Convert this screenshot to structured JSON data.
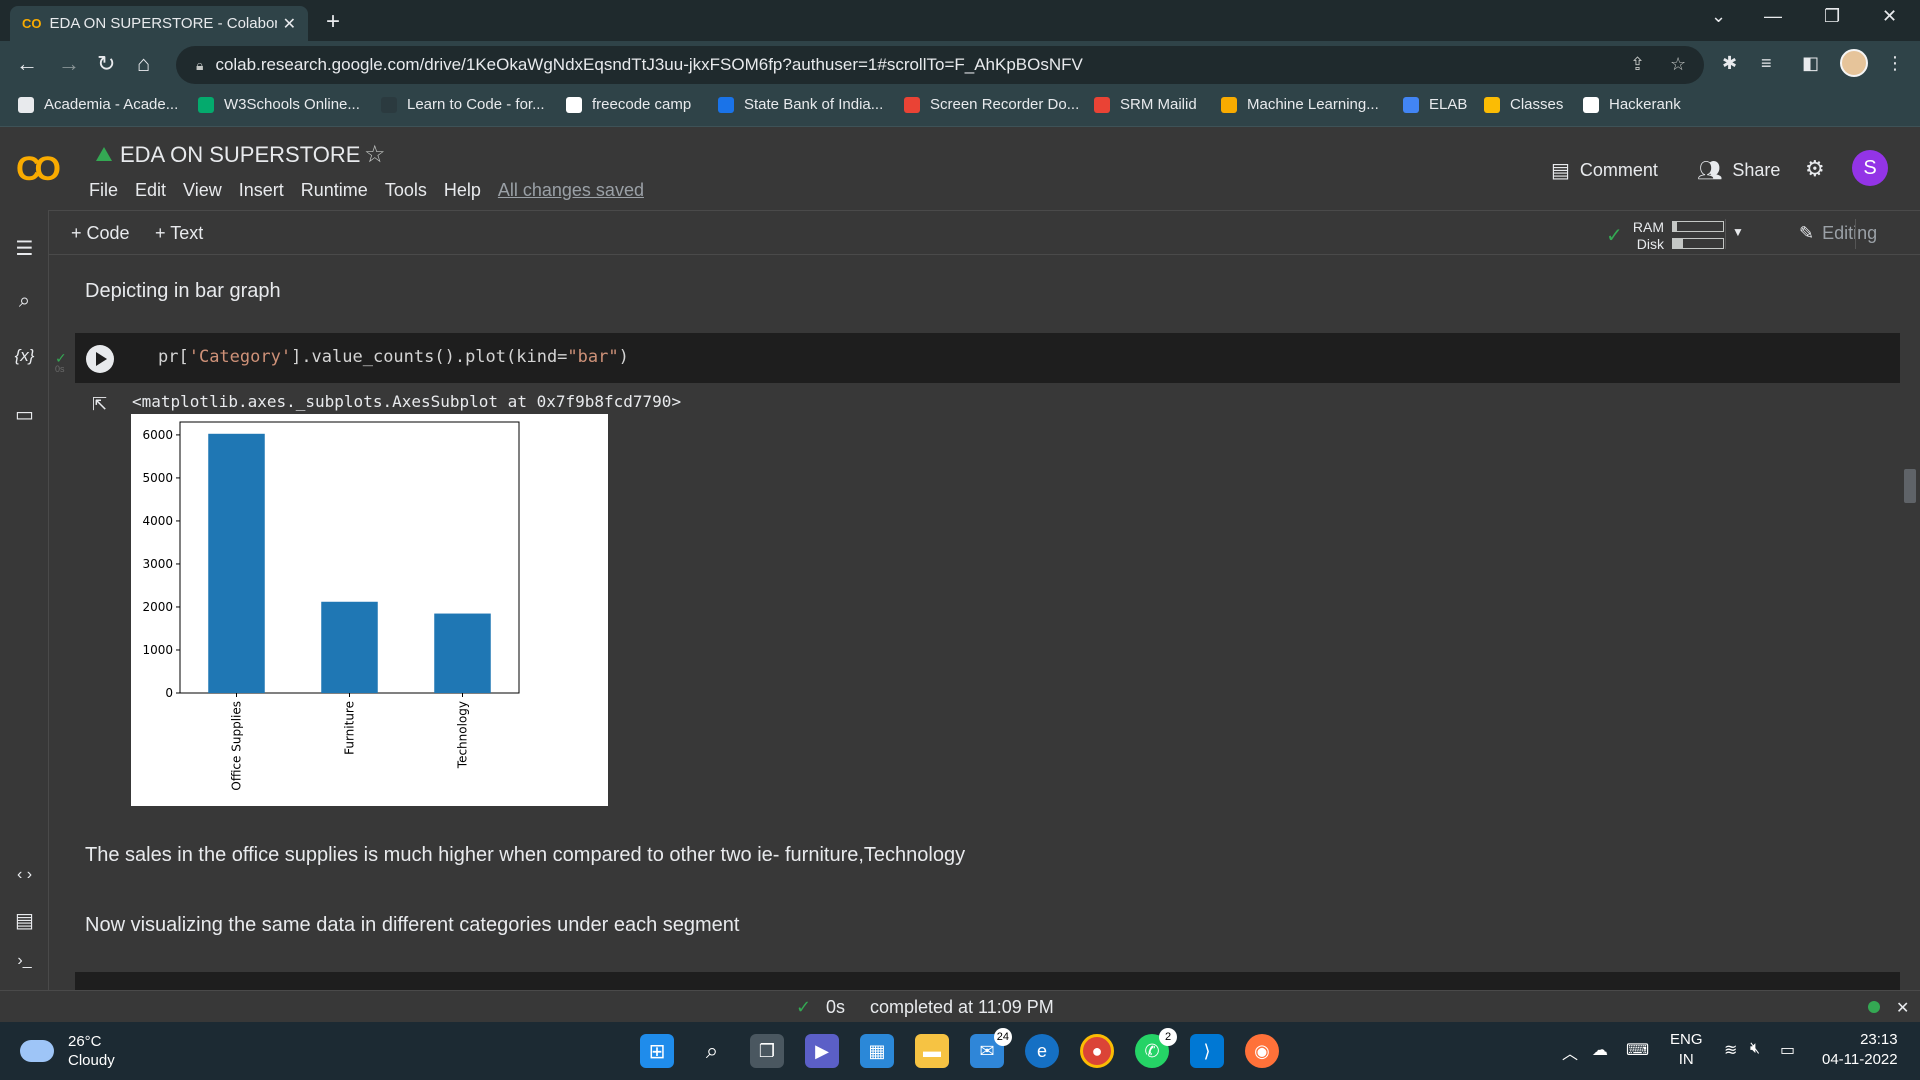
{
  "browser": {
    "tab_title": "EDA ON SUPERSTORE - Colaboratory",
    "url": "colab.research.google.com/drive/1KeOkaWgNdxEqsndTtJ3uu-jkxFSOM6fp?authuser=1#scrollTo=F_AhKpBOsNFV",
    "bookmarks": [
      {
        "label": "Academia - Acade...",
        "icon": "academia-icon",
        "color": "#e8eaed"
      },
      {
        "label": "W3Schools Online...",
        "icon": "w3schools-icon",
        "color": "#04aa6d"
      },
      {
        "label": "Learn to Code - for...",
        "icon": "freecodecamp-icon",
        "color": "#2b3a3f"
      },
      {
        "label": "freecode camp",
        "icon": "freecodecamp-icon",
        "color": "#ffffff"
      },
      {
        "label": "State Bank of India...",
        "icon": "sbi-icon",
        "color": "#1a73e8"
      },
      {
        "label": "Screen Recorder Do...",
        "icon": "record-icon",
        "color": "#ea4335"
      },
      {
        "label": "SRM Mailid",
        "icon": "gmail-icon",
        "color": "#ea4335"
      },
      {
        "label": "Machine Learning...",
        "icon": "ml-icon",
        "color": "#f9ab00"
      },
      {
        "label": "ELAB",
        "icon": "elab-icon",
        "color": "#4285f4"
      },
      {
        "label": "Classes",
        "icon": "classroom-icon",
        "color": "#fbbc04"
      },
      {
        "label": "Hackerank",
        "icon": "hackerrank-icon",
        "color": "#ffffff"
      }
    ]
  },
  "colab": {
    "logo": "CO",
    "notebook_name": "EDA ON SUPERSTORE",
    "menu": [
      "File",
      "Edit",
      "View",
      "Insert",
      "Runtime",
      "Tools",
      "Help"
    ],
    "saved_status": "All changes saved",
    "comment_label": "Comment",
    "share_label": "Share",
    "avatar_letter": "S",
    "add_code_label": "+ Code",
    "add_text_label": "+ Text",
    "ram_label": "RAM",
    "disk_label": "Disk",
    "ram_usage": 0.08,
    "disk_usage": 0.2,
    "editing_label": "Editing"
  },
  "cells": {
    "md_heading": "Depicting in bar graph",
    "code_prefix": "pr[",
    "code_str1": "'Category'",
    "code_mid": "].value_counts().plot(kind=",
    "code_str2": "\"bar\"",
    "code_suffix": ")",
    "exec_time": "0s",
    "output_text": "<matplotlib.axes._subplots.AxesSubplot at 0x7f9b8fcd7790>",
    "md_conclusion": "The sales in the office supplies is much higher when compared to other two ie- furniture,Technology",
    "md_next": "Now visualizing the same data in different categories under each segment"
  },
  "chart_data": {
    "type": "bar",
    "categories": [
      "Office Supplies",
      "Furniture",
      "Technology"
    ],
    "values": [
      6026,
      2121,
      1847
    ],
    "title": "",
    "xlabel": "",
    "ylabel": "",
    "ylim": [
      0,
      6300
    ],
    "yticks": [
      0,
      1000,
      2000,
      3000,
      4000,
      5000,
      6000
    ],
    "bar_color": "#1f77b4",
    "grid": false
  },
  "statusbar": {
    "exec_time": "0s",
    "completed_text": "completed at 11:09 PM"
  },
  "taskbar": {
    "temperature": "26°C",
    "weather": "Cloudy",
    "mail_badge": "24",
    "whatsapp_badge": "2",
    "lang_top": "ENG",
    "lang_bottom": "IN",
    "time": "23:13",
    "date": "04-11-2022"
  }
}
